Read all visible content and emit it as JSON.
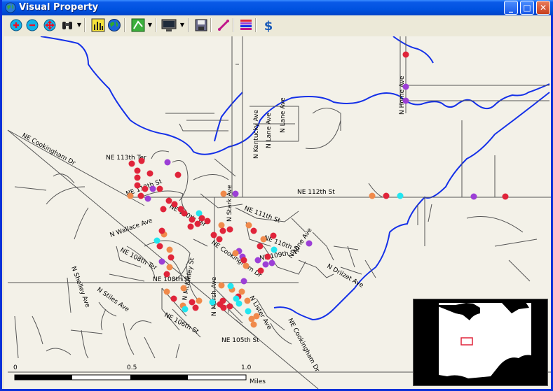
{
  "window": {
    "title": "Visual Property"
  },
  "toolbar": {
    "buttons": [
      {
        "name": "zoom-in-icon"
      },
      {
        "name": "zoom-out-icon"
      },
      {
        "name": "pan-icon"
      },
      {
        "name": "binoculars-icon"
      },
      {
        "name": "bar-chart-icon"
      },
      {
        "name": "globe-icon"
      },
      {
        "name": "layer-icon"
      },
      {
        "name": "display-icon"
      },
      {
        "name": "save-icon"
      },
      {
        "name": "measure-icon"
      },
      {
        "name": "legend-icon"
      },
      {
        "name": "dollar-icon"
      }
    ]
  },
  "map": {
    "street_labels": {
      "ne_cookingham_dr_west": "NE Cookingham Dr",
      "ne_113th_ter": "NE 113th Ter",
      "ne_112th_st_west": "NE 112th St",
      "ne_110th_ter": "NE 110th Ter",
      "n_wallace_ave": "N Wallace Ave",
      "n_stark_ave": "N Stark Ave",
      "ne_111th_st": "NE 111th St",
      "ne_110th_st": "NE 110th St",
      "ne_109th_st": "NE 109th St",
      "n_lane_ave_south": "N Lane Ave",
      "n_drilzet_ave": "N Drilzet Ave",
      "ne_108th_ter": "NE 108th Ter",
      "ne_108th_st": "NE 108th St",
      "ne_cookingham_dr_mid": "NE Cookingham Dr",
      "n_mckinley_st": "N McKinley St",
      "n_marsh_ave": "N Marsh Ave",
      "n_shelley_ave": "N Shelley Ave",
      "n_stiles_ave": "N Stiles Ave",
      "ne_105th_st": "NE 105th St",
      "ne_106th_st": "NE 106th St",
      "ne_105th_st_b": "NE 105th St",
      "n_lister_ave": "N Lister Ave",
      "ne_cookingham_dr_south": "NE Cookingham Dr",
      "n_kentucky_ave": "N Kentucky Ave",
      "n_lane_ave_north": "N Lane Ave",
      "n_lane_ave_north2": "N Lane Ave",
      "n_home_ave": "N Home Ave",
      "ne_112th_st_east": "NE 112th St"
    },
    "scale_bar": {
      "label0": "0",
      "label1": "0.5",
      "label2": "1.0",
      "unit": "Miles"
    },
    "colors": {
      "red": "#e0243a",
      "orange": "#f08a4b",
      "purple": "#9c3fd6",
      "cyan": "#22e6f0",
      "river": "#1430e8",
      "road": "#555555"
    }
  }
}
